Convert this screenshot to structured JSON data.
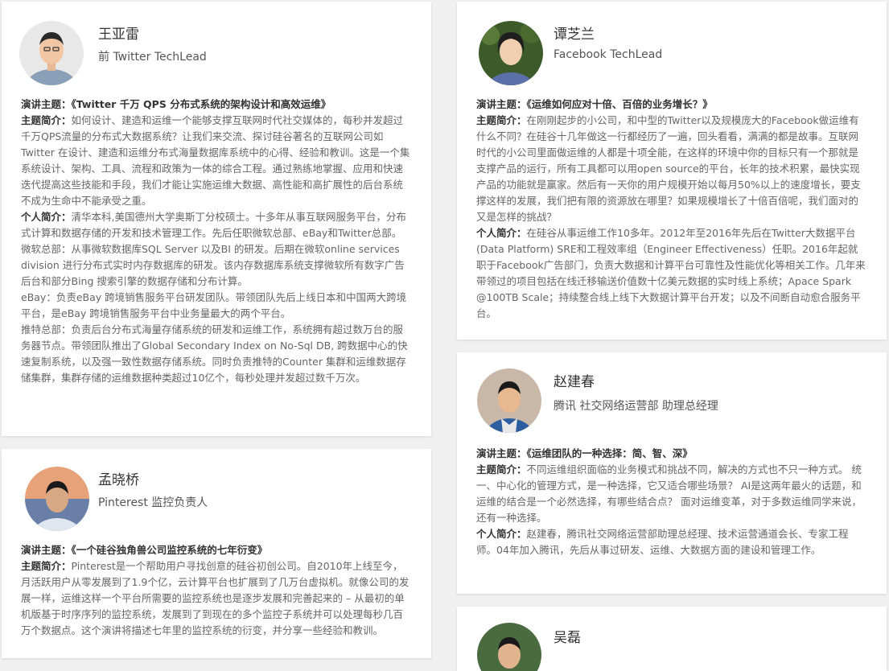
{
  "speakers": [
    {
      "name": "王亚雷",
      "title": "前 Twitter TechLead",
      "topic_label": "演讲主题：",
      "topic": "《Twitter 千万 QPS 分布式系统的架构设计和高效运维》",
      "summary_label": "主题简介：",
      "summary": "如何设计、建造和运维一个能够支撑互联网时代社交媒体的，每秒并发超过千万QPS流量的分布式大数据系统？让我们来交流、探讨硅谷著名的互联网公司如Twitter 在设计、建造和运维分布式海量数据库系统中的心得、经验和教训。这是一个集系统设计、架构、工具、流程和政策为一体的综合工程。通过熟练地掌握、应用和快速迭代提高这些技能和手段，我们才能让实施运维大数据、高性能和高扩展性的后台系统不成为生命中不能承受之重。",
      "bio_label": "个人简介：",
      "bio": "清华本科,美国德州大学奥斯丁分校硕士。十多年从事互联网服务平台，分布式计算和数据存储的开发和技术管理工作。先后任职微软总部、eBay和Twitter总部。",
      "extra": [
        "微软总部：从事微软数据库SQL Server 以及BI 的研发。后期在微软online services division 进行分布式实时内存数据库的研发。该内存数据库系统支撑微软所有数字广告后台和部分Bing 搜索引擎的数据存储和分布计算。",
        "eBay：负责eBay 跨境销售服务平台研发团队。带领团队先后上线日本和中国两大跨境平台，是eBay 跨境销售服务平台中业务量最大的两个平台。",
        "推特总部：负责后台分布式海量存储系统的研发和运维工作，系统拥有超过数万台的服务器节点。带领团队推出了Global Secondary Index on No-Sql DB, 跨数据中心的快速复制系统，以及强一致性数据存储系统。同时负责推特的Counter 集群和运维数据存储集群，集群存储的运维数据种类超过10亿个，每秒处理并发超过数千万次。"
      ]
    },
    {
      "name": "谭芝兰",
      "title": "Facebook TechLead",
      "topic_label": "演讲主题：",
      "topic": "《运维如何应对十倍、百倍的业务增长？》",
      "summary_label": "主题简介：",
      "summary": "在刚刚起步的小公司，和中型的Twitter以及规模庞大的Facebook做运维有什么不同？在硅谷十几年做这一行都经历了一遍，回头看看，满满的都是故事。互联网时代的小公司里面做运维的人都是十项全能，在这样的环境中你的目标只有一个那就是支撑产品的运行，所有工具都可以用open source的平台，长年的技术积累，最快实现产品的功能就是赢家。然后有一天你的用户规模开始以每月50%以上的速度增长，要支撑这样的发展，我们把有限的资源放在哪里？如果规模增长了十倍百倍呢，我们面对的又是怎样的挑战？",
      "bio_label": "个人简介：",
      "bio": "在硅谷从事运维工作10多年。2012年至2016年先后在Twitter大数据平台(Data Platform) SRE和工程效率组（Engineer Effectiveness）任职。2016年起就职于Facebook广告部门，负责大数据和计算平台可靠性及性能优化等相关工作。几年来带领过的项目包括在线迁移输送价值数十亿美元数据的实时线上系统；Apace Spark @100TB Scale；持续整合线上线下大数据计算平台开发；以及不间断自动愈合服务平台。"
    },
    {
      "name": "赵建春",
      "title": "腾讯 社交网络运营部 助理总经理",
      "topic_label": "演讲主题：",
      "topic": "《运维团队的一种选择：简、智、深》",
      "summary_label": "主题简介：",
      "summary": "不同运维组织面临的业务模式和挑战不同，解决的方式也不只一种方式。 统一、中心化的管理方式，是一种选择，它又适合哪些场景？ AI是这两年最火的话题，和运维的结合是一个必然选择，有哪些结合点？ 面对运维变革，对于多数运维同学来说，还有一种选择。",
      "bio_label": "个人简介：",
      "bio": "赵建春，腾讯社交网络运营部助理总经理、技术运营通道会长、专家工程师。04年加入腾讯，先后从事过研发、运维、大数据方面的建设和管理工作。"
    },
    {
      "name": "孟晓桥",
      "title": "Pinterest 监控负责人",
      "topic_label": "演讲主题：",
      "topic": "《一个硅谷独角兽公司监控系统的七年衍变》",
      "summary_label": "主题简介：",
      "summary": "Pinterest是一个帮助用户寻找创意的硅谷初创公司。自2010年上线至今，月活跃用户从零发展到了1.9个亿，云计算平台也扩展到了几万台虚拟机。就像公司的发展一样，运维这样一个平台所需要的监控系统也是逐步发展和完善起来的 – 从最初的单机版基于时序序列的监控系统，发展到了到现在的多个监控子系统并可以处理每秒几百万个数据点。这个演讲将描述七年里的监控系统的衍变，并分享一些经验和教训。"
    },
    {
      "name": "吴磊"
    }
  ]
}
